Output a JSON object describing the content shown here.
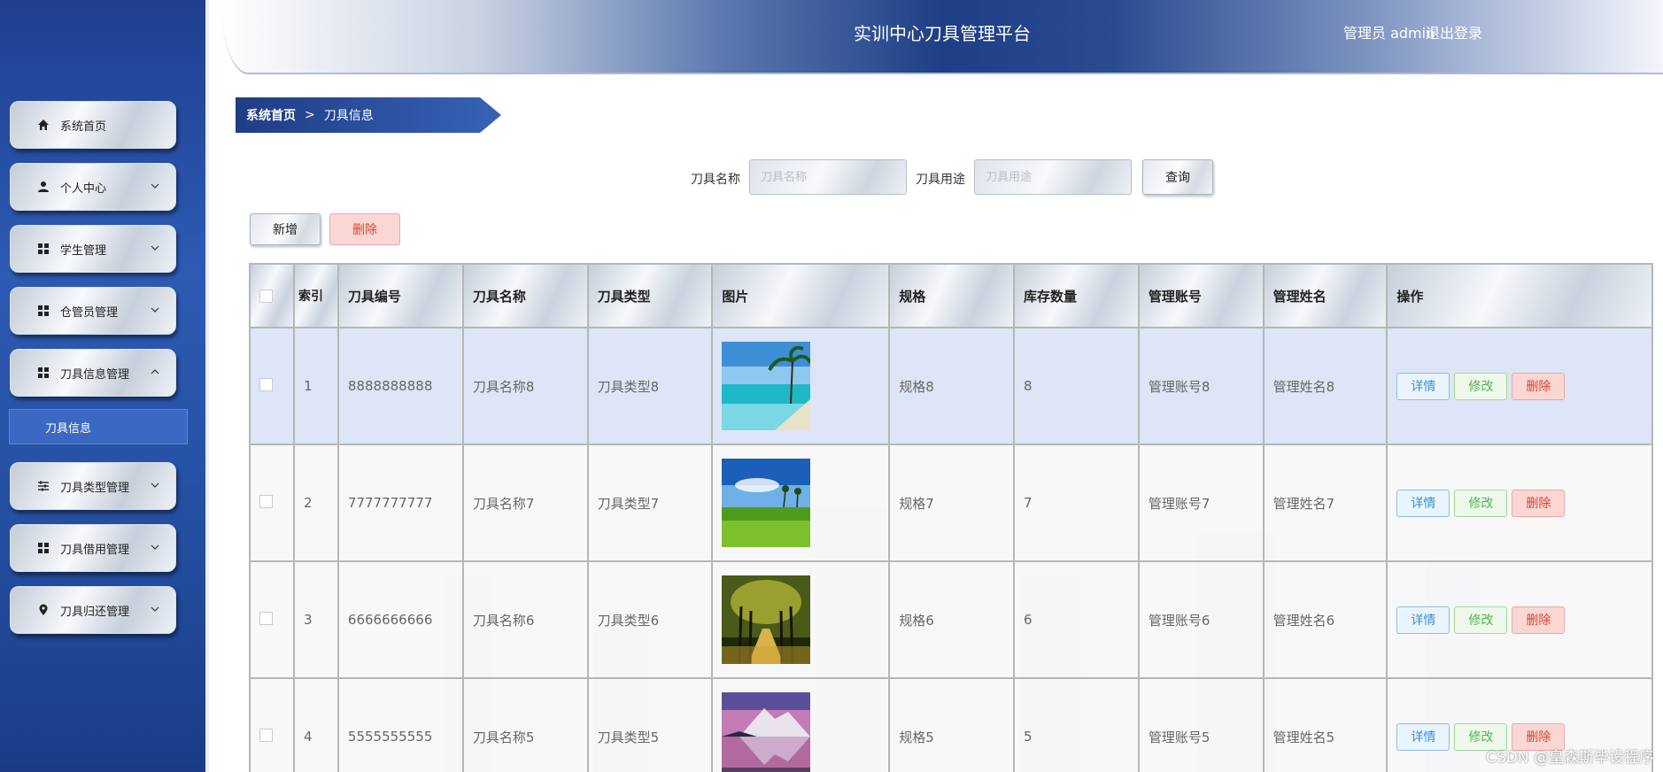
{
  "header": {
    "title": "实训中心刀具管理平台",
    "user": "管理员 admin",
    "logout": "退出登录"
  },
  "sidebar": {
    "items": [
      {
        "label": "系统首页",
        "icon": "home-icon",
        "expandable": false
      },
      {
        "label": "个人中心",
        "icon": "user-icon",
        "expandable": true
      },
      {
        "label": "学生管理",
        "icon": "grid-icon",
        "expandable": true
      },
      {
        "label": "仓管员管理",
        "icon": "grid-icon",
        "expandable": true
      },
      {
        "label": "刀具信息管理",
        "icon": "grid-icon",
        "expandable": true,
        "expanded": true
      },
      {
        "label": "刀具类型管理",
        "icon": "sliders-icon",
        "expandable": true
      },
      {
        "label": "刀具借用管理",
        "icon": "grid-icon",
        "expandable": true
      },
      {
        "label": "刀具归还管理",
        "icon": "location-icon",
        "expandable": true
      }
    ],
    "submenu": {
      "label": "刀具信息"
    }
  },
  "breadcrumb": {
    "home": "系统首页",
    "sep": ">",
    "current": "刀具信息"
  },
  "search": {
    "name_label": "刀具名称",
    "name_placeholder": "刀具名称",
    "use_label": "刀具用途",
    "use_placeholder": "刀具用途",
    "query_button": "查询"
  },
  "actions": {
    "add": "新增",
    "delete": "删除"
  },
  "table": {
    "headers": {
      "index": "索引",
      "code": "刀具编号",
      "name": "刀具名称",
      "type": "刀具类型",
      "image": "图片",
      "spec": "规格",
      "stock": "库存数量",
      "account": "管理账号",
      "manager": "管理姓名",
      "ops": "操作"
    },
    "row_actions": {
      "detail": "详情",
      "edit": "修改",
      "delete": "删除"
    },
    "rows": [
      {
        "index": "1",
        "code": "8888888888",
        "name": "刀具名称8",
        "type": "刀具类型8",
        "image": "beach-photo",
        "spec": "规格8",
        "stock": "8",
        "account": "管理账号8",
        "manager": "管理姓名8"
      },
      {
        "index": "2",
        "code": "7777777777",
        "name": "刀具名称7",
        "type": "刀具类型7",
        "image": "meadow-photo",
        "spec": "规格7",
        "stock": "7",
        "account": "管理账号7",
        "manager": "管理姓名7"
      },
      {
        "index": "3",
        "code": "6666666666",
        "name": "刀具名称6",
        "type": "刀具类型6",
        "image": "tree-path-photo",
        "spec": "规格6",
        "stock": "6",
        "account": "管理账号6",
        "manager": "管理姓名6"
      },
      {
        "index": "4",
        "code": "5555555555",
        "name": "刀具名称5",
        "type": "刀具类型5",
        "image": "mountain-lake-photo",
        "spec": "规格5",
        "stock": "5",
        "account": "管理账号5",
        "manager": "管理姓名5"
      }
    ]
  },
  "watermark": "CSDN @皇森斯毕设程序"
}
